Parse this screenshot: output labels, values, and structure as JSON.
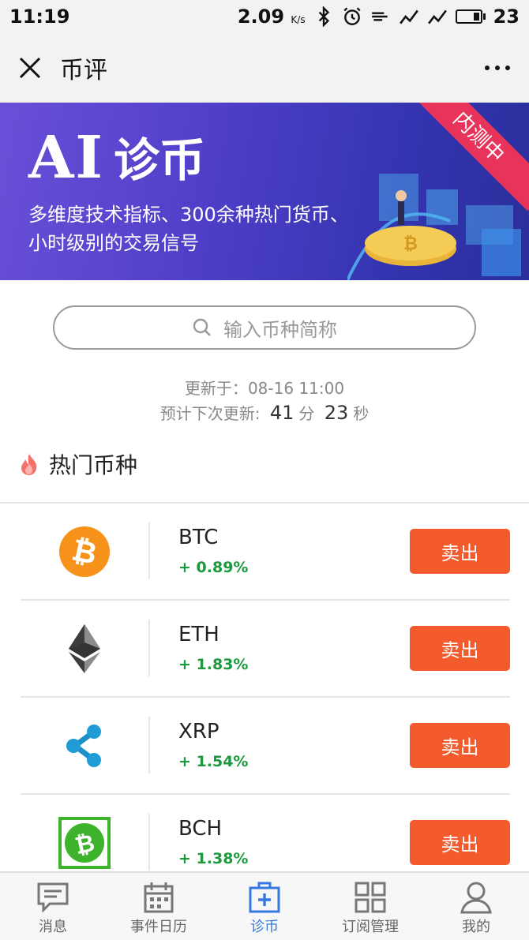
{
  "status_bar": {
    "time": "11:19",
    "speed": "2.09",
    "speed_unit": "K/s",
    "battery": "23"
  },
  "nav": {
    "title": "币评"
  },
  "banner": {
    "title_latin": "AI",
    "title_zh": "诊币",
    "subtitle_line1": "多维度技术指标、300余种热门货币、",
    "subtitle_line2": "小时级别的交易信号",
    "ribbon": "内测中"
  },
  "search": {
    "placeholder": "输入币种简称"
  },
  "update": {
    "label": "更新于：",
    "time": "08-16 11:00",
    "next_label": "预计下次更新:",
    "minutes": "41",
    "min_unit": "分",
    "seconds": "23",
    "sec_unit": "秒"
  },
  "hot": {
    "title": "热门币种"
  },
  "coins": [
    {
      "symbol": "BTC",
      "change": "+ 0.89%",
      "action": "卖出",
      "icon": "bitcoin-icon"
    },
    {
      "symbol": "ETH",
      "change": "+ 1.83%",
      "action": "卖出",
      "icon": "ethereum-icon"
    },
    {
      "symbol": "XRP",
      "change": "+ 1.54%",
      "action": "卖出",
      "icon": "ripple-icon"
    },
    {
      "symbol": "BCH",
      "change": "+ 1.38%",
      "action": "卖出",
      "icon": "bitcoin-cash-icon"
    }
  ],
  "tabs": [
    {
      "label": "消息",
      "icon": "message-icon"
    },
    {
      "label": "事件日历",
      "icon": "calendar-icon"
    },
    {
      "label": "诊币",
      "icon": "medical-kit-icon",
      "active": true
    },
    {
      "label": "订阅管理",
      "icon": "grid-icon"
    },
    {
      "label": "我的",
      "icon": "user-icon"
    }
  ],
  "colors": {
    "accent": "#3478e0",
    "sell": "#f35b2c",
    "positive": "#1a9a3c",
    "ribbon": "#e8335b"
  }
}
